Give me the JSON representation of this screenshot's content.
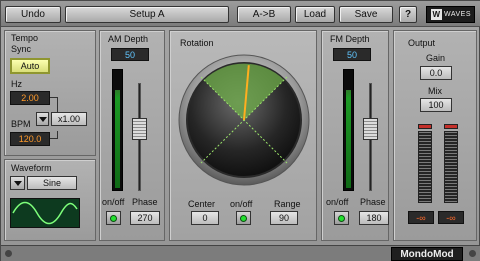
{
  "toolbar": {
    "undo_label": "Undo",
    "preset_name": "Setup A",
    "ab_label": "A->B",
    "load_label": "Load",
    "save_label": "Save",
    "help_label": "?",
    "logo_text": "WAVES",
    "logo_mark": "W"
  },
  "tempo": {
    "title_line1": "Tempo",
    "title_line2": "Sync",
    "sync_value": "Auto",
    "hz_label": "Hz",
    "hz_value": "2.00",
    "bpm_label": "BPM",
    "bpm_value": "120.0",
    "multiplier_value": "x1.00"
  },
  "waveform": {
    "title": "Waveform",
    "selected": "Sine",
    "shape": "sine-wave"
  },
  "am": {
    "title": "AM Depth",
    "depth_value": "50",
    "onoff_label": "on/off",
    "phase_label": "Phase",
    "phase_value": "270",
    "meter_level": 0.85,
    "slider_position": 0.5
  },
  "rotation": {
    "title": "Rotation",
    "center_label": "Center",
    "center_value": "0",
    "onoff_label": "on/off",
    "range_label": "Range",
    "range_value": "90",
    "needle_angle_deg": 5
  },
  "fm": {
    "title": "FM Depth",
    "depth_value": "50",
    "onoff_label": "on/off",
    "phase_label": "Phase",
    "phase_value": "180",
    "meter_level": 0.85,
    "slider_position": 0.5
  },
  "output": {
    "title": "Output",
    "gain_label": "Gain",
    "gain_value": "0.0",
    "mix_label": "Mix",
    "mix_value": "100",
    "left_peak": "-∞",
    "right_peak": "-∞"
  },
  "footer": {
    "plugin_name": "MondoMod"
  },
  "colors": {
    "led_green": "#23e02f",
    "display_orange": "#ff9a2a",
    "display_blue": "#61c6ff",
    "radar_green": "#6fae4a"
  }
}
